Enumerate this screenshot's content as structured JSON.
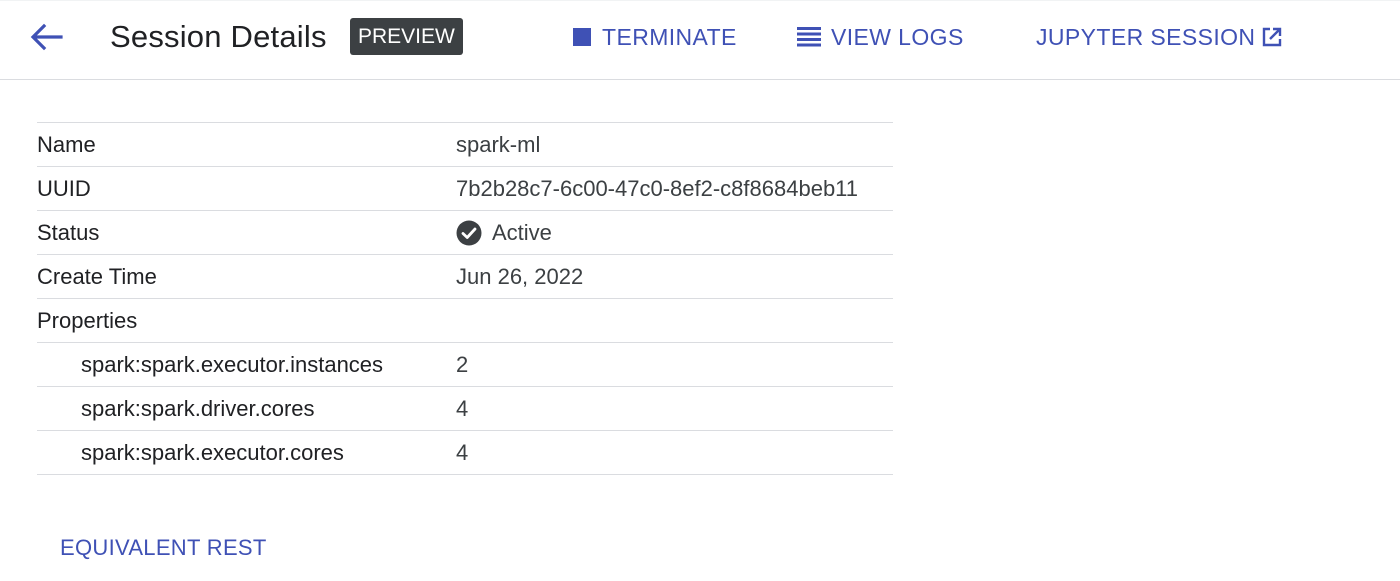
{
  "header": {
    "back_icon": "arrow-back-icon",
    "title": "Session Details",
    "badge": "PREVIEW",
    "actions": {
      "terminate": {
        "label": "TERMINATE",
        "icon": "stop-square-icon"
      },
      "view_logs": {
        "label": "VIEW LOGS",
        "icon": "list-lines-icon"
      },
      "jupyter": {
        "label": "JUPYTER SESSION",
        "icon": "open-in-new-icon"
      }
    }
  },
  "details": {
    "name": {
      "label": "Name",
      "value": "spark-ml"
    },
    "uuid": {
      "label": "UUID",
      "value": "7b2b28c7-6c00-47c0-8ef2-c8f8684beb11"
    },
    "status": {
      "label": "Status",
      "value": "Active",
      "icon": "check-circle-icon"
    },
    "create_time": {
      "label": "Create Time",
      "value": "Jun 26, 2022"
    },
    "properties": {
      "label": "Properties",
      "items": [
        {
          "key": "spark:spark.executor.instances",
          "value": "2"
        },
        {
          "key": "spark:spark.driver.cores",
          "value": "4"
        },
        {
          "key": "spark:spark.executor.cores",
          "value": "4"
        }
      ]
    }
  },
  "footer": {
    "rest_link": "EQUIVALENT REST"
  },
  "colors": {
    "accent": "#3f51b5",
    "badge_bg": "#3c4043",
    "divider": "#dadce0",
    "status_icon": "#3c4043"
  }
}
